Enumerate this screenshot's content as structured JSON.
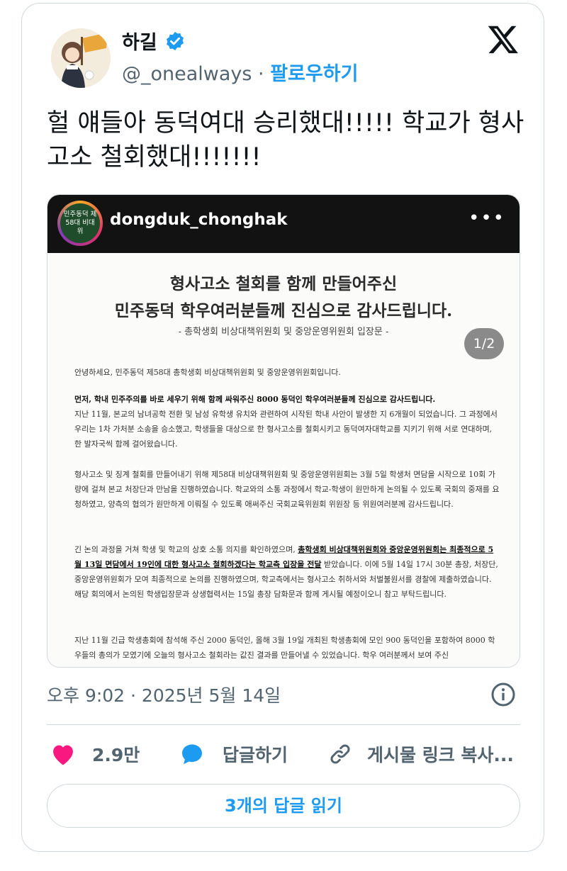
{
  "tweet": {
    "author_name": "하길",
    "handle": "@_onealways",
    "separator": " · ",
    "follow_label": "팔로우하기",
    "text": "헐 얘들아 동덕여대 승리했대!!!!! 학교가 형사고소 철회했대!!!!!!!",
    "timestamp": "오후 9:02 · 2025년 5월 14일",
    "likes": "2.9만",
    "reply_label": "답글하기",
    "copy_link_label": "게시물 링크 복사...",
    "read_replies_label": "3개의 답글 읽기"
  },
  "embedded_post": {
    "username": "dongduk_chonghak",
    "avatar_text": "민주동덕 제58대 비대위",
    "page_indicator": "1/2",
    "doc": {
      "title_line1": "형사고소 철회를 함께 만들어주신",
      "title_line2": "민주동덕 학우여러분들께 진심으로 감사드립니다.",
      "subtitle": "- 총학생회 비상대책위원회 및 중앙운영위원회 입장문 -",
      "para1": "안녕하세요, 민주동덕 제58대 총학생회 비상대책위원회 및 중앙운영위원회입니다.",
      "para2_bold": "먼저, 학내 민주주의를 바로 세우기 위해 함께 싸워주신 8000 동덕인 학우여러분들께 진심으로 감사드립니다.",
      "para2": "지난 11월, 본교의 남녀공학 전환 및 남성 유학생 유치와 관련하여 시작된 학내 사안이 발생한 지 6개월이 되었습니다. 그 과정에서 우리는 1차 가처분 소송을 승소했고, 학생들을 대상으로 한 형사고소를 철회시키고 동덕여자대학교를 지키기 위해 서로 연대하며, 한 발자국씩 함께 걸어왔습니다.",
      "para3": "형사고소 및 징계 철회를 만들어내기 위해 제58대 비상대책위원회 및 중앙운영위원회는 3월 5일 학생처 면담을 시작으로 10회 가량에 걸쳐 본교 처장단과 만남을 진행하였습니다. 학교와의 소통 과정에서 학교-학생이 원만하게 논의될 수 있도록 국회의 중재를 요청하였고, 양측의 협의가 원만하게 이뤄질 수 있도록 애써주신 국회교육위원회 위원장 등 위원여러분께 감사드립니다.",
      "para4_a": "긴 논의 과정을 거쳐 학생 및 학교의 상호 소통 의지를 확인하였으며, ",
      "para4_u": "총학생회 비상대책위원회와 중앙운영위원회는 최종적으로 5월 13일 면담에서 19인에 대한 형사고소 철회하겠다는 학교측 입장을 전달",
      "para4_b": " 받았습니다. 이에 5월 14일 17시 30분 총장, 처장단, 중앙운영위원회가 모여 최종적으로 논의를 진행하였으며, 학교측에서는 형사고소 취하서와 처벌불원서를 경찰에 제출하였습니다. 해당 회의에서 논의된 학생입장문과 상생협력서는 15일 총장 담화문과 함께 게시될 예정이오니 참고 부탁드립니다.",
      "para5": "지난 11월 긴급 학생총회에 참석해 주신 2000 동덕인, 올해 3월 19일 개최된 학생총회에 모인 900 동덕인을 포함하여 8000 학우들의 총의가 모였기에 오늘의 형사고소 철회라는 값진 결과를 만들어낼 수 있었습니다. 학우 여러분께서 보여 주신"
    }
  },
  "colors": {
    "accent": "#1d9bf0",
    "like": "#f91880",
    "secondary_text": "#536471",
    "border": "#cfd9de"
  },
  "icons": [
    "verified-badge-icon",
    "x-logo-icon",
    "info-icon",
    "heart-icon",
    "reply-bubble-icon",
    "link-icon",
    "more-dots-icon"
  ]
}
